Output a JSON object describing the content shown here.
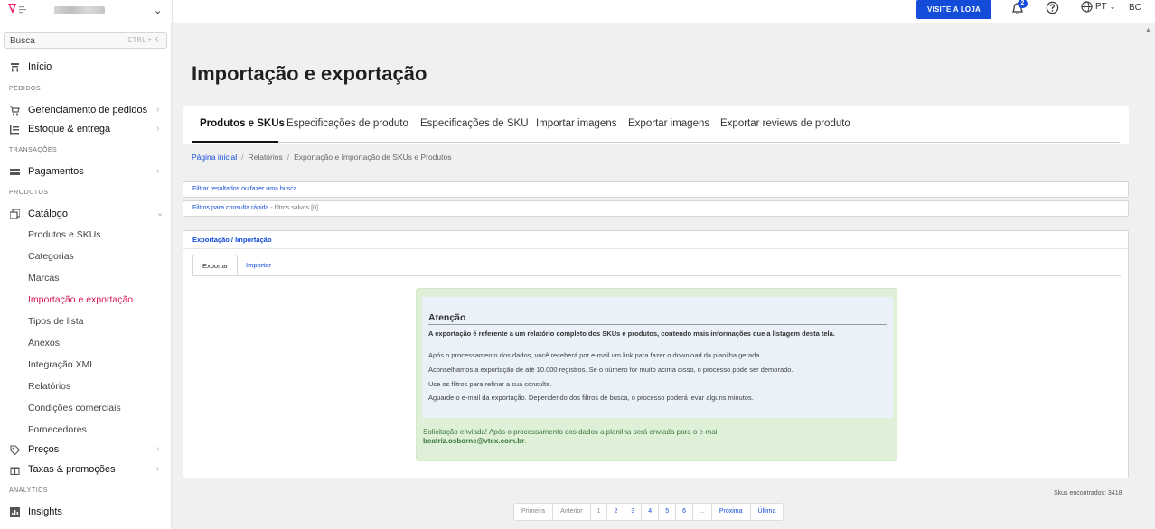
{
  "topbar": {
    "visit_store": "VISITE A LOJA",
    "notification_count": "2",
    "language": "PT",
    "user_initials": "BC"
  },
  "sidebar": {
    "search_placeholder": "Busca",
    "search_shortcut": "CTRL + K",
    "home": "Início",
    "sections": {
      "orders": "PEDIDOS",
      "transactions": "TRANSAÇÕES",
      "products": "PRODUTOS",
      "analytics": "ANALYTICS"
    },
    "order_management": "Gerenciamento de pedidos",
    "inventory": "Estoque & entrega",
    "payments": "Pagamentos",
    "catalog": "Catálogo",
    "catalog_items": [
      "Produtos e SKUs",
      "Categorias",
      "Marcas",
      "Importação e exportação",
      "Tipos de lista",
      "Anexos",
      "Integração XML",
      "Relatórios",
      "Condições comerciais",
      "Fornecedores"
    ],
    "prices": "Preços",
    "taxes": "Taxas & promoções",
    "insights": "Insights"
  },
  "main": {
    "title": "Importação e exportação",
    "tabs": [
      "Produtos e SKUs",
      "Especificações de produto",
      "Especificações de SKU",
      "Importar imagens",
      "Exportar imagens",
      "Exportar reviews de produto"
    ],
    "breadcrumb": {
      "home": "Página inicial",
      "reports": "Relatórios",
      "current": "Exportação e Importação de SKUs e Produtos"
    },
    "filter_search": "Filtrar resultados ou fazer uma busca",
    "quick_filters": "Filtros para consulta rápida",
    "saved_filters": " - filtros salvos [0]",
    "panel_title": "Exportação / Importação",
    "subtab_export": "Exportar",
    "subtab_import": "Importar",
    "notice": {
      "title": "Atenção",
      "bold": "A exportação é referente a um relatório completo dos SKUs e produtos, contendo mais informações que a listagem desta tela.",
      "lines": [
        "Após o processamento dos dados, você receberá por e-mail um link para fazer o download da planilha gerada.",
        "Aconselhamos a exportação de até 10.000 registros. Se o número for muito acima disso, o processo pode ser demorado.",
        "Use os filtros para refinar a sua consulta.",
        "Aguarde o e-mail da exportação. Dependendo dos filtros de busca, o processo poderá levar alguns minutos."
      ],
      "success_text": "Solicitação enviada! Após o processamento dos dados a planilha será enviada para o e-mail",
      "email": "beatriz.osborne@vtex.com.br"
    },
    "skus_found": "Skus encontrados: 3418",
    "pagination": {
      "first": "Primeira",
      "previous": "Anterior",
      "pages": [
        "1",
        "2",
        "3",
        "4",
        "5",
        "6"
      ],
      "ellipsis": "...",
      "next": "Próxima",
      "last": "Última"
    }
  }
}
